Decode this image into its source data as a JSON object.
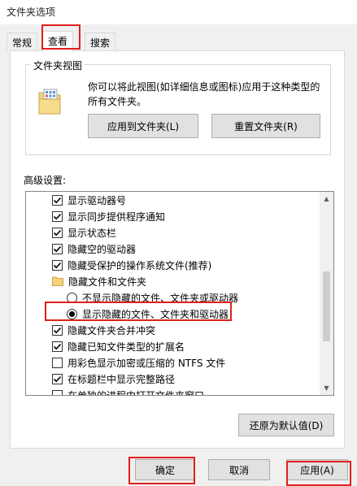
{
  "window": {
    "title": "文件夹选项"
  },
  "tabs": [
    {
      "label": "常规"
    },
    {
      "label": "查看"
    },
    {
      "label": "搜索"
    }
  ],
  "folder_view": {
    "label": "文件夹视图",
    "description": "你可以将此视图(如详细信息或图标)应用于这种类型的所有文件夹。",
    "apply_button": "应用到文件夹(L)",
    "reset_button": "重置文件夹(R)"
  },
  "advanced": {
    "label": "高级设置:",
    "items": [
      {
        "kind": "checkbox",
        "checked": true,
        "label": "显示驱动器号"
      },
      {
        "kind": "checkbox",
        "checked": true,
        "label": "显示同步提供程序通知"
      },
      {
        "kind": "checkbox",
        "checked": true,
        "label": "显示状态栏"
      },
      {
        "kind": "checkbox",
        "checked": true,
        "label": "隐藏空的驱动器"
      },
      {
        "kind": "checkbox",
        "checked": true,
        "label": "隐藏受保护的操作系统文件(推荐)"
      },
      {
        "kind": "folder",
        "label": "隐藏文件和文件夹"
      },
      {
        "kind": "radio",
        "checked": false,
        "label": "不显示隐藏的文件、文件夹或驱动器"
      },
      {
        "kind": "radio",
        "checked": true,
        "label": "显示隐藏的文件、文件夹和驱动器"
      },
      {
        "kind": "checkbox",
        "checked": true,
        "label": "隐藏文件夹合并冲突"
      },
      {
        "kind": "checkbox",
        "checked": true,
        "label": "隐藏已知文件类型的扩展名"
      },
      {
        "kind": "checkbox",
        "checked": false,
        "label": "用彩色显示加密或压缩的 NTFS 文件"
      },
      {
        "kind": "checkbox",
        "checked": true,
        "label": "在标题栏中显示完整路径"
      },
      {
        "kind": "checkbox",
        "checked": false,
        "label": "在单独的进程中打开文件夹窗口"
      }
    ],
    "restore_defaults": "还原为默认值(D)"
  },
  "footer": {
    "ok": "确定",
    "cancel": "取消",
    "apply": "应用(A)"
  },
  "colors": {
    "highlight": "#e0201c",
    "window_bg": "#f0f0f0"
  }
}
